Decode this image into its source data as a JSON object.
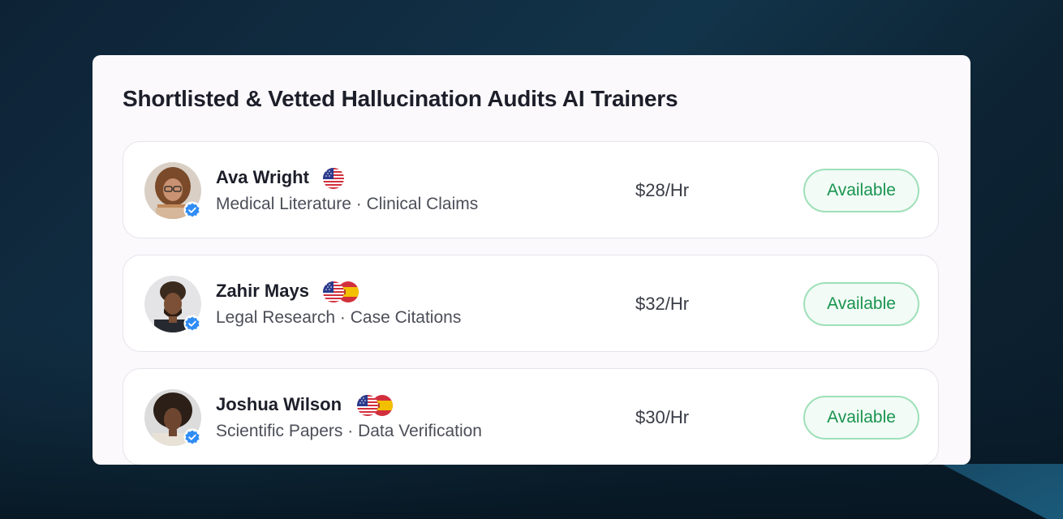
{
  "title": "Shortlisted & Vetted Hallucination Audits AI Trainers",
  "colors": {
    "accent_green": "#19944f",
    "verified_blue": "#2f8cf5"
  },
  "trainers": [
    {
      "name": "Ava Wright",
      "flags": [
        "us-flag-icon"
      ],
      "skills": "Medical Literature · Clinical Claims",
      "rate": "$28/Hr",
      "status": "Available"
    },
    {
      "name": "Zahir Mays",
      "flags": [
        "us-flag-icon",
        "spain-flag-icon"
      ],
      "skills": "Legal Research · Case Citations",
      "rate": "$32/Hr",
      "status": "Available"
    },
    {
      "name": "Joshua Wilson",
      "flags": [
        "us-flag-icon",
        "spain-flag-icon"
      ],
      "skills": "Scientific Papers · Data Verification",
      "rate": "$30/Hr",
      "status": "Available"
    }
  ]
}
